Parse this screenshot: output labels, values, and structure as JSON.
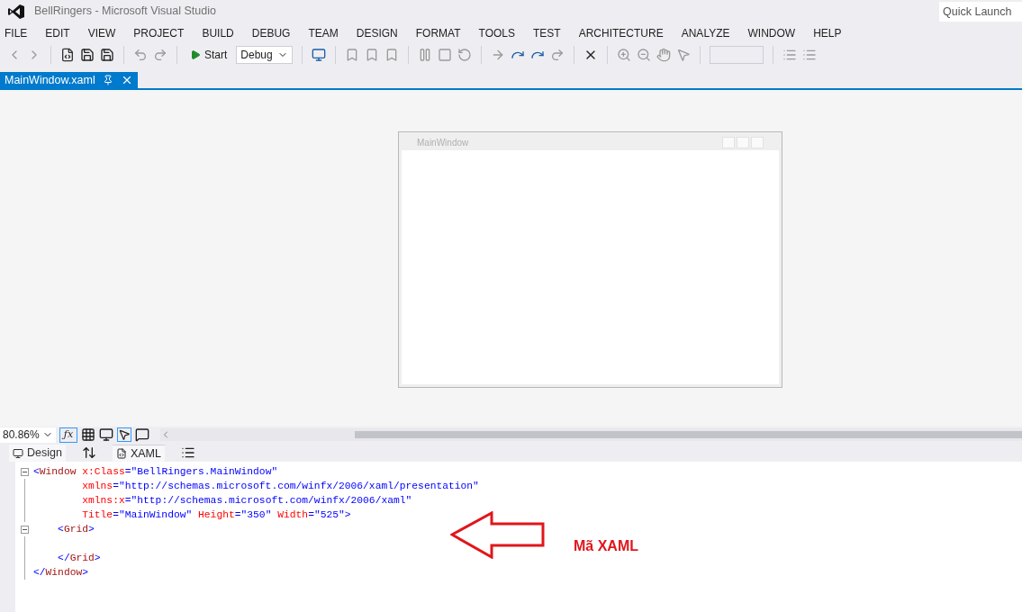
{
  "window": {
    "title": "BellRingers - Microsoft Visual Studio"
  },
  "quick_launch": {
    "placeholder": "Quick Launch"
  },
  "menu": [
    "FILE",
    "EDIT",
    "VIEW",
    "PROJECT",
    "BUILD",
    "DEBUG",
    "TEAM",
    "DESIGN",
    "FORMAT",
    "TOOLS",
    "TEST",
    "ARCHITECTURE",
    "ANALYZE",
    "WINDOW",
    "HELP"
  ],
  "toolbar": {
    "start": "Start",
    "configuration": "Debug"
  },
  "document_tabs": [
    {
      "label": "MainWindow.xaml",
      "selected": true
    }
  ],
  "designer": {
    "window_title": "MainWindow"
  },
  "zoom_bar": {
    "zoom": "80.86%",
    "formula": "ƒx"
  },
  "view_tabs": [
    {
      "label": "Design",
      "selected": false
    },
    {
      "label": "XAML",
      "selected": true
    }
  ],
  "code": [
    {
      "foldable": true,
      "tokens": [
        {
          "kind": "punct",
          "text": "<"
        },
        {
          "kind": "tag",
          "text": "Window"
        },
        {
          "kind": "attr",
          "text": " x:Class"
        },
        {
          "kind": "punct",
          "text": "=\"BellRingers.MainWindow\""
        }
      ]
    },
    {
      "foldable": false,
      "tokens": [
        {
          "kind": "attr",
          "text": "        xmlns"
        },
        {
          "kind": "punct",
          "text": "=\"http://schemas.microsoft.com/winfx/2006/xaml/presentation\""
        }
      ]
    },
    {
      "foldable": false,
      "tokens": [
        {
          "kind": "attr",
          "text": "        xmlns:x"
        },
        {
          "kind": "punct",
          "text": "=\"http://schemas.microsoft.com/winfx/2006/xaml\""
        }
      ]
    },
    {
      "foldable": false,
      "tokens": [
        {
          "kind": "attr",
          "text": "        Title"
        },
        {
          "kind": "punct",
          "text": "=\"MainWindow\""
        },
        {
          "kind": "attr",
          "text": " Height"
        },
        {
          "kind": "punct",
          "text": "=\"350\""
        },
        {
          "kind": "attr",
          "text": " Width"
        },
        {
          "kind": "punct",
          "text": "=\"525\">"
        }
      ]
    },
    {
      "foldable": true,
      "tokens": [
        {
          "kind": "punct",
          "text": "    <"
        },
        {
          "kind": "tag",
          "text": "Grid"
        },
        {
          "kind": "punct",
          "text": ">"
        }
      ]
    },
    {
      "foldable": false
    },
    {
      "foldable": false,
      "tokens": [
        {
          "kind": "punct",
          "text": "    </"
        },
        {
          "kind": "tag",
          "text": "Grid"
        },
        {
          "kind": "punct",
          "text": ">"
        }
      ]
    },
    {
      "foldable": false,
      "tokens": [
        {
          "kind": "punct",
          "text": "</"
        },
        {
          "kind": "tag",
          "text": "Window"
        },
        {
          "kind": "punct",
          "text": ">"
        }
      ]
    }
  ],
  "annotation": {
    "label": "Mã XAML"
  }
}
